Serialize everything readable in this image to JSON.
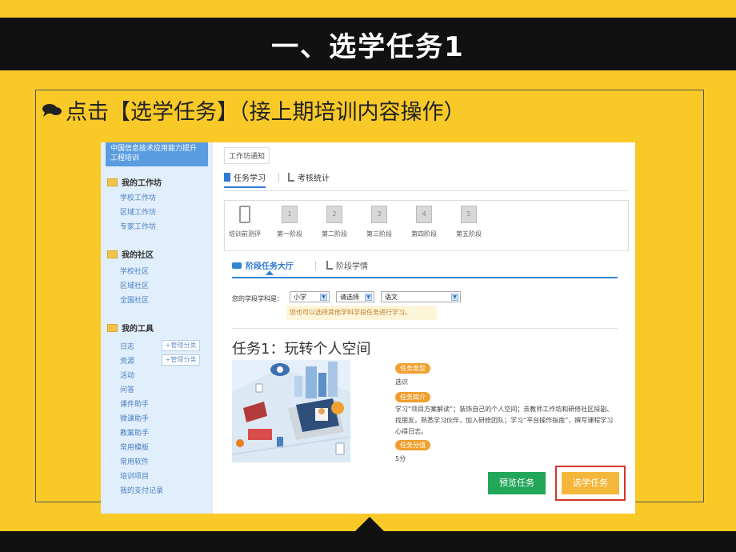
{
  "slide": {
    "title": "一、选学任务1",
    "instruction": "点击【选学任务】（接上期培训内容操作）"
  },
  "sidebar": {
    "top_banner": "中国信息技术应用能力提升工程培训",
    "sections": [
      {
        "title": "我的工作坊",
        "items": [
          "学校工作坊",
          "区域工作坊",
          "专家工作坊"
        ]
      },
      {
        "title": "我的社区",
        "items": [
          "学校社区",
          "区域社区",
          "全国社区"
        ]
      },
      {
        "title": "我的工具",
        "items": [
          "日志",
          "资源",
          "活动",
          "问答",
          "课件助手",
          "微课助手",
          "教案助手",
          "常用模板",
          "常用软件",
          "培训项目",
          "我的支付记录"
        ]
      }
    ],
    "manage_label": "+管理分类"
  },
  "main": {
    "notice_tab": "工作坊通知",
    "tabs": [
      "任务学习",
      "考核统计"
    ],
    "stages": [
      "培训前测评",
      "第一阶段",
      "第二阶段",
      "第三阶段",
      "第四阶段",
      "第五阶段"
    ],
    "stage_numbers": [
      "1",
      "2",
      "3",
      "4",
      "5"
    ],
    "hall_tabs": [
      "阶段任务大厅",
      "阶段学情"
    ],
    "subject_label": "您的学段学科是：",
    "selects": {
      "stage": "小学",
      "grade": "请选择",
      "subject": "语文"
    },
    "hint": "您也可以选择其他学科学段任务进行学习。",
    "task": {
      "title": "任务1：玩转个人空间",
      "type_badge": "任务类型",
      "type_value": "选识",
      "intro_badge": "任务简介",
      "intro_line1": "学习“项目方案解读”；装饰自己的个人空间；去教师工作坊和研修社区探副、",
      "intro_line2": "找朋友，熟悉学习伙伴，加入研修团队；学习“平台操作指南”，撰写课程学习",
      "intro_line3": "心得日志。",
      "score_badge": "任务分值",
      "score_value": "5分"
    },
    "buttons": {
      "preview": "预览任务",
      "select": "选学任务"
    }
  },
  "colors": {
    "slide_bg": "#f9c928",
    "bar": "#111111",
    "accent_blue": "#2f7ad1",
    "green": "#22a65a",
    "orange": "#f5b73a",
    "highlight_red": "#d9342b"
  }
}
